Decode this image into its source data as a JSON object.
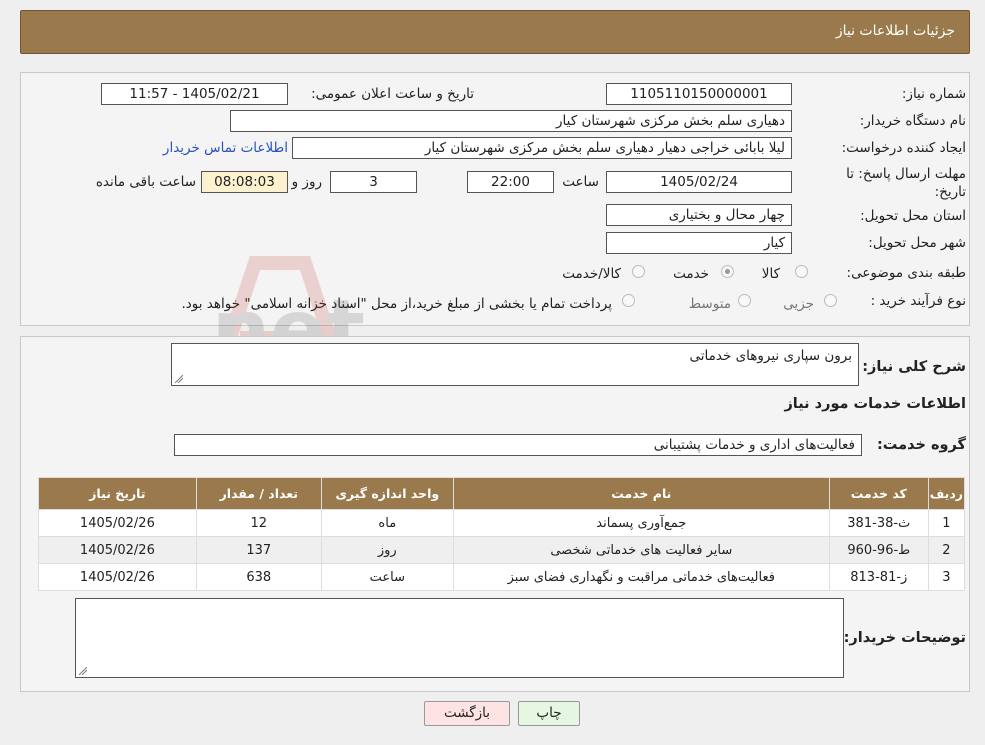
{
  "header": {
    "title": "جزئیات اطلاعات نیاز"
  },
  "form": {
    "need_number_label": "شماره نیاز:",
    "need_number": "1105110150000001",
    "announce_label": "تاریخ و ساعت اعلان عمومی:",
    "announce_value": "1405/02/21 - 11:57",
    "buyer_org_label": "نام دستگاه خریدار:",
    "buyer_org": "دهیاری سلم بخش مرکزی شهرستان کیار",
    "creator_label": "ایجاد کننده درخواست:",
    "creator": "لیلا بابائی خراجی دهیار دهیاری سلم بخش مرکزی شهرستان کیار",
    "contact_link": "اطلاعات تماس خریدار",
    "deadline_label": "مهلت ارسال پاسخ: تا تاریخ:",
    "deadline_date": "1405/02/24",
    "time_label": "ساعت",
    "deadline_time": "22:00",
    "days_value": "3",
    "days_label": "روز و",
    "remaining_time": "08:08:03",
    "remaining_label": "ساعت باقی مانده",
    "province_label": "استان محل تحویل:",
    "province": "چهار محال و بختیاری",
    "city_label": "شهر محل تحویل:",
    "city": "کیار",
    "category_label": "طبقه بندی موضوعی:",
    "category_options": [
      "کالا",
      "خدمت",
      "کالا/خدمت"
    ],
    "category_selected": "خدمت",
    "process_label": "نوع فرآیند خرید :",
    "process_options": [
      "جزیی",
      "متوسط"
    ],
    "process_note": "پرداخت تمام یا بخشی از مبلغ خرید،از محل \"اسناد خزانه اسلامی\" خواهد بود."
  },
  "details": {
    "summary_label": "شرح کلی نیاز:",
    "summary": "برون سپاری نیروهای خدماتی",
    "services_title": "اطلاعات خدمات مورد نیاز",
    "group_label": "گروه خدمت:",
    "group": "فعالیت‌های اداری و خدمات پشتیبانی",
    "table": {
      "headers": [
        "ردیف",
        "کد خدمت",
        "نام خدمت",
        "واحد اندازه گیری",
        "تعداد / مقدار",
        "تاریخ نیاز"
      ],
      "rows": [
        [
          "1",
          "ث-38-381",
          "جمع‌آوری پسماند",
          "ماه",
          "12",
          "1405/02/26"
        ],
        [
          "2",
          "ط-96-960",
          "سایر فعالیت های خدماتی شخصی",
          "روز",
          "137",
          "1405/02/26"
        ],
        [
          "3",
          "ز-81-813",
          "فعالیت‌های خدماتی مراقبت و نگهداری فضای سبز",
          "ساعت",
          "638",
          "1405/02/26"
        ]
      ]
    },
    "buyer_notes_label": "توضیحات خریدار:",
    "buyer_notes": ""
  },
  "buttons": {
    "print": "چاپ",
    "back": "بازگشت"
  },
  "watermark": {
    "text": "AriaTender.net"
  },
  "colors": {
    "header_bg": "#9a7a4c",
    "back_button_bg": "#fde3e3",
    "print_button_bg": "#e6f7e1",
    "link": "#2a52be"
  }
}
